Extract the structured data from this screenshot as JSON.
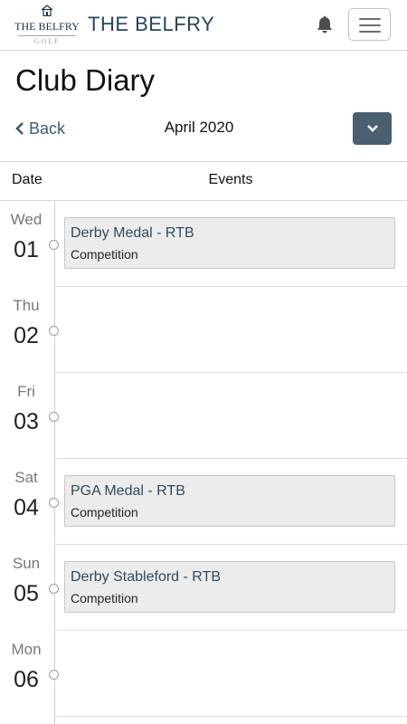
{
  "header": {
    "logo_wordmark": "THE BELFRY",
    "logo_sub": "GOLF",
    "brand": "THE BELFRY",
    "icons": [
      "house-icon",
      "bell-icon",
      "hamburger-menu-icon"
    ]
  },
  "page": {
    "title": "Club Diary",
    "back_label": "Back",
    "month": "April 2020"
  },
  "columns": {
    "date": "Date",
    "events": "Events"
  },
  "days": [
    {
      "dow": "Wed",
      "num": "01",
      "event": {
        "name": "Derby Medal - RTB",
        "type": "Competition"
      }
    },
    {
      "dow": "Thu",
      "num": "02",
      "event": null
    },
    {
      "dow": "Fri",
      "num": "03",
      "event": null
    },
    {
      "dow": "Sat",
      "num": "04",
      "event": {
        "name": "PGA Medal - RTB",
        "type": "Competition"
      }
    },
    {
      "dow": "Sun",
      "num": "05",
      "event": {
        "name": "Derby Stableford - RTB",
        "type": "Competition"
      }
    },
    {
      "dow": "Mon",
      "num": "06",
      "event": null
    }
  ],
  "colors": {
    "brand_navy": "#27445e",
    "month_button": "#4a5f70",
    "event_bg": "#ececec",
    "event_title": "#2f4a60"
  }
}
